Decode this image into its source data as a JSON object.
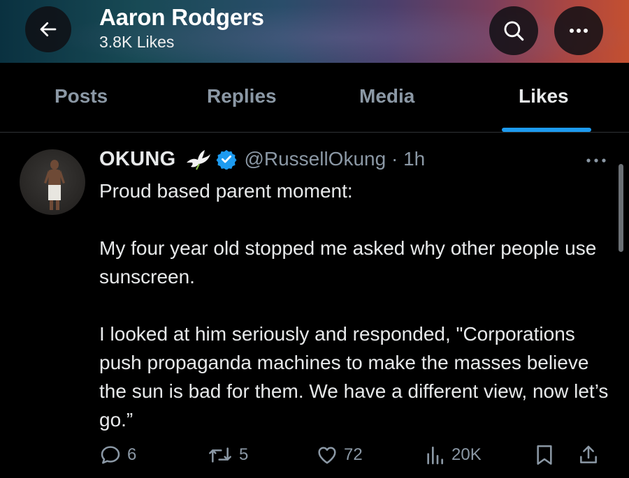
{
  "header": {
    "title": "Aaron Rodgers",
    "subtitle": "3.8K Likes"
  },
  "tabs": [
    {
      "label": "Posts",
      "active": false
    },
    {
      "label": "Replies",
      "active": false
    },
    {
      "label": "Media",
      "active": false
    },
    {
      "label": "Likes",
      "active": true
    }
  ],
  "tweet": {
    "display_name": "OKUNG",
    "handle_time": "@RussellOkung · 1h",
    "text": "Proud based parent moment:\n\nMy four year old stopped me asked why other people use sunscreen.\n\nI looked at him seriously and responded, \"Corporations push propaganda machines to make the masses believe the sun is bad for them. We have a different view, now let’s go.”",
    "replies": "6",
    "reposts": "5",
    "likes": "72",
    "views": "20K"
  },
  "icons": {
    "back": "arrow-left-icon",
    "search": "search-icon",
    "more": "more-horizontal-icon",
    "dove": "dove-icon",
    "verified": "verified-badge-icon",
    "reply": "reply-icon",
    "repost": "repost-icon",
    "like": "heart-icon",
    "views": "analytics-icon",
    "bookmark": "bookmark-icon",
    "share": "share-icon"
  },
  "colors": {
    "accent": "#1d9bf0",
    "background": "#000000",
    "secondary_text": "#8b98a5"
  }
}
